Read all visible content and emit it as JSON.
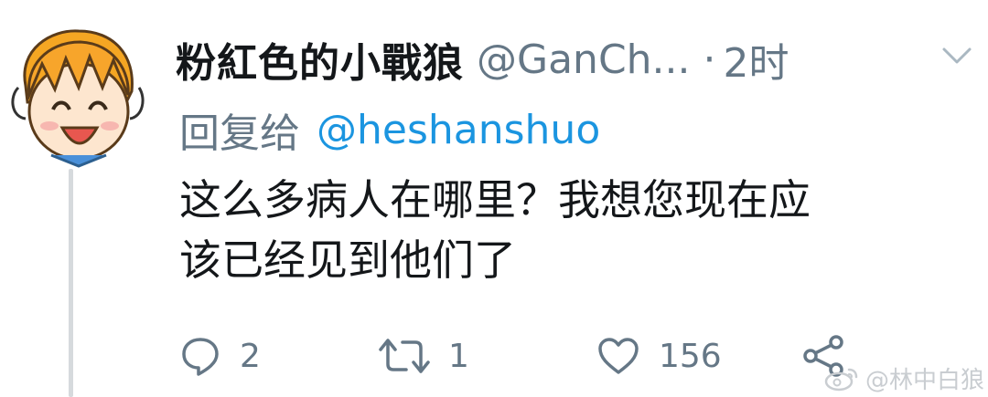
{
  "tweet": {
    "author": {
      "display_name": "粉紅色的小戰狼",
      "handle": "@GanCh...",
      "avatar_icon": "cartoon-avatar-orange-hair"
    },
    "separator": "·",
    "time": "2时",
    "reply_to_label": "回复给",
    "reply_to_user": "@heshanshuo",
    "text": "这么多病人在哪里？我想您现在应\n该已经见到他们了",
    "actions": {
      "reply_count": "2",
      "retweet_count": "1",
      "like_count": "156"
    }
  },
  "watermark": {
    "text": "@林中白狼",
    "icon": "weibo-icon"
  },
  "colors": {
    "text": "#14171a",
    "muted": "#657786",
    "link": "#1b95e0",
    "thread_line": "#d6dadd"
  }
}
